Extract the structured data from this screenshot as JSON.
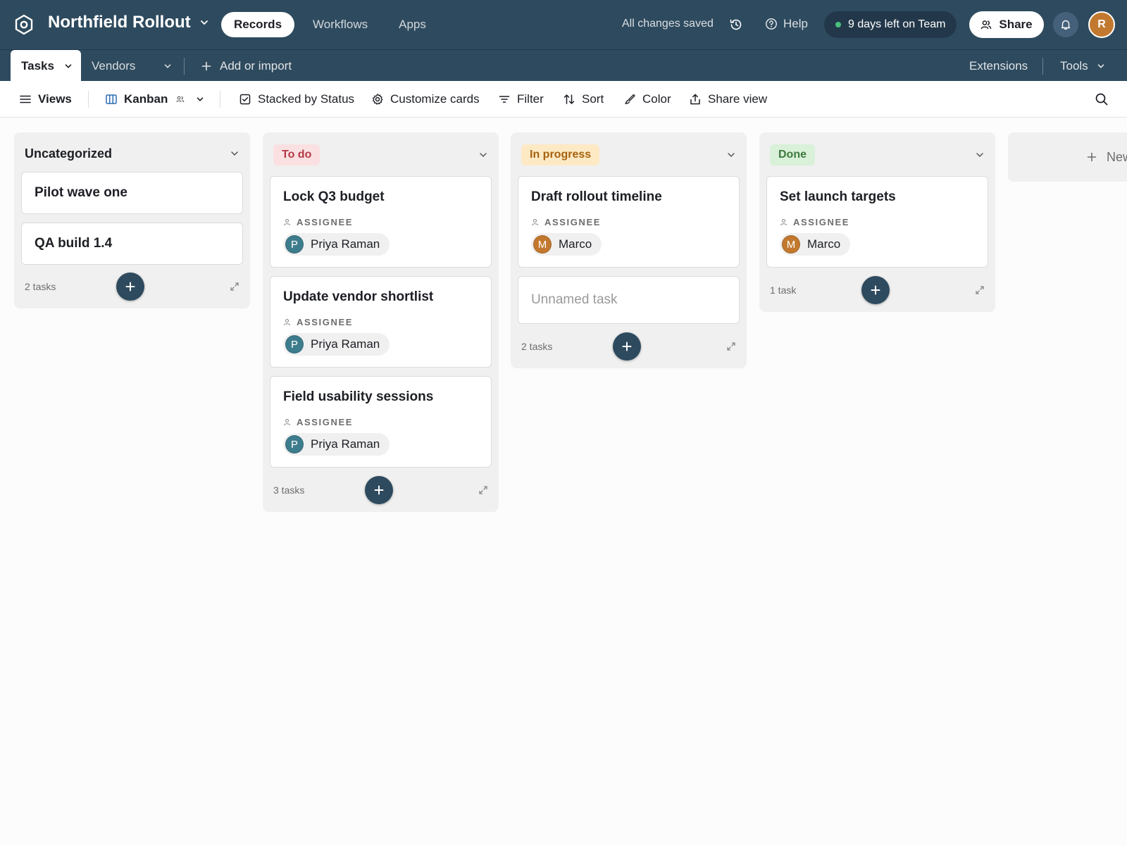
{
  "topbar": {
    "base_name": "Northfield Rollout",
    "nav": [
      "Records",
      "Workflows",
      "Apps"
    ],
    "saved_status": "All changes saved",
    "help_label": "Help",
    "trial_label": "9 days left on Team",
    "share_label": "Share",
    "user_initial": "R"
  },
  "tabs": {
    "active": "Tasks",
    "other": "Vendors",
    "add_import": "Add or import",
    "extensions": "Extensions",
    "tools": "Tools"
  },
  "viewbar": {
    "views": "Views",
    "view_name": "Kanban",
    "stacked_by": "Stacked by Status",
    "customize": "Customize cards",
    "filter": "Filter",
    "sort": "Sort",
    "color": "Color",
    "share_view": "Share view"
  },
  "board": {
    "field_label": "ASSIGNEE",
    "new_stack_label": "New",
    "columns": [
      {
        "title": "Uncategorized",
        "count": "2 tasks",
        "cards": [
          {
            "title": "Pilot wave one"
          },
          {
            "title": "QA build 1.4"
          }
        ]
      },
      {
        "title": "To do",
        "color": "#fbe0e2",
        "text_color": "#b33a48",
        "count": "3 tasks",
        "cards": [
          {
            "title": "Lock Q3 budget",
            "assignee": "Priya Raman",
            "initial": "P"
          },
          {
            "title": "Update vendor shortlist",
            "assignee": "Priya Raman",
            "initial": "P"
          },
          {
            "title": "Field usability sessions",
            "assignee": "Priya Raman",
            "initial": "P"
          }
        ]
      },
      {
        "title": "In progress",
        "color": "#fde9c4",
        "text_color": "#a5620d",
        "count": "2 tasks",
        "cards": [
          {
            "title": "Draft rollout timeline",
            "assignee": "Marco",
            "initial": "M"
          },
          {
            "title": "Unnamed task"
          }
        ]
      },
      {
        "title": "Done",
        "color": "#d9f0d9",
        "text_color": "#3d7a3d",
        "count": "1 task",
        "cards": [
          {
            "title": "Set launch targets",
            "assignee": "Marco",
            "initial": "M"
          }
        ]
      }
    ]
  },
  "colors": {
    "header_bg": "#2e4a5e",
    "accent_button": "#2e4a5e",
    "user_avatar": "#c2792f",
    "trial_dot": "#4bbf7e"
  }
}
